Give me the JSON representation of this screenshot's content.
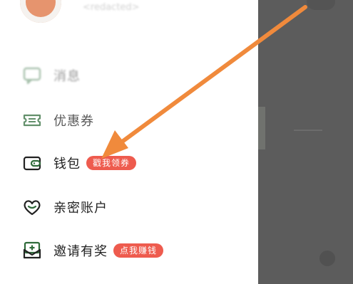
{
  "profile": {
    "subtitle": "<redacted>"
  },
  "menu": {
    "items": [
      {
        "key": "messages",
        "label": "消息",
        "icon": "chat-icon",
        "badge": ""
      },
      {
        "key": "coupons",
        "label": "优惠券",
        "icon": "coupon-icon",
        "badge": ""
      },
      {
        "key": "wallet",
        "label": "钱包",
        "icon": "wallet-icon",
        "badge": "戳我领券"
      },
      {
        "key": "family",
        "label": "亲密账户",
        "icon": "heart-icon",
        "badge": ""
      },
      {
        "key": "invite",
        "label": "邀请有奖",
        "icon": "envelope-plus-icon",
        "badge": "点我赚钱"
      }
    ]
  },
  "colors": {
    "icon_green": "#2f6b3a",
    "badge_red": "#ee5b4e",
    "scrim": "#5c5c5c",
    "arrow": "#f08a3c"
  },
  "annotation": {
    "arrow_color": "#f08a3c"
  }
}
